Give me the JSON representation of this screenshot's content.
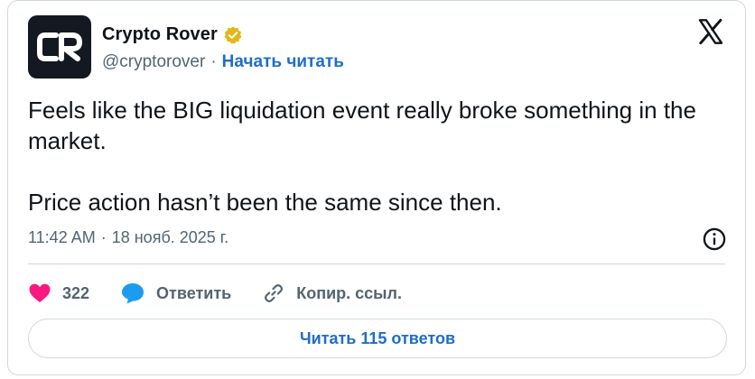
{
  "author": {
    "display_name": "Crypto Rover",
    "handle": "@cryptorover",
    "separator": "·",
    "follow_label": "Начать читать",
    "verified_color": "#e2b719"
  },
  "tweet": {
    "paragraphs": [
      "Feels like the BIG liquidation event really broke something in the market.",
      "Price action hasn’t been the same since then."
    ],
    "time": "11:42 AM",
    "date_separator": "·",
    "date": "18 нояб. 2025 г."
  },
  "actions": {
    "likes_count": "322",
    "reply_label": "Ответить",
    "copy_link_label": "Копир. ссыл."
  },
  "replies_button_label": "Читать 115 ответов",
  "colors": {
    "like": "#f91880",
    "reply": "#1d9bf0",
    "link": "#1d6ec8",
    "muted": "#536471",
    "border": "#cfd9de"
  },
  "icons": {
    "avatar": "crypto-rover-logo",
    "verified": "verified-badge-icon",
    "platform": "x-logo-icon",
    "info": "info-icon",
    "like": "heart-icon",
    "reply": "speech-bubble-icon",
    "copy_link": "link-icon"
  }
}
